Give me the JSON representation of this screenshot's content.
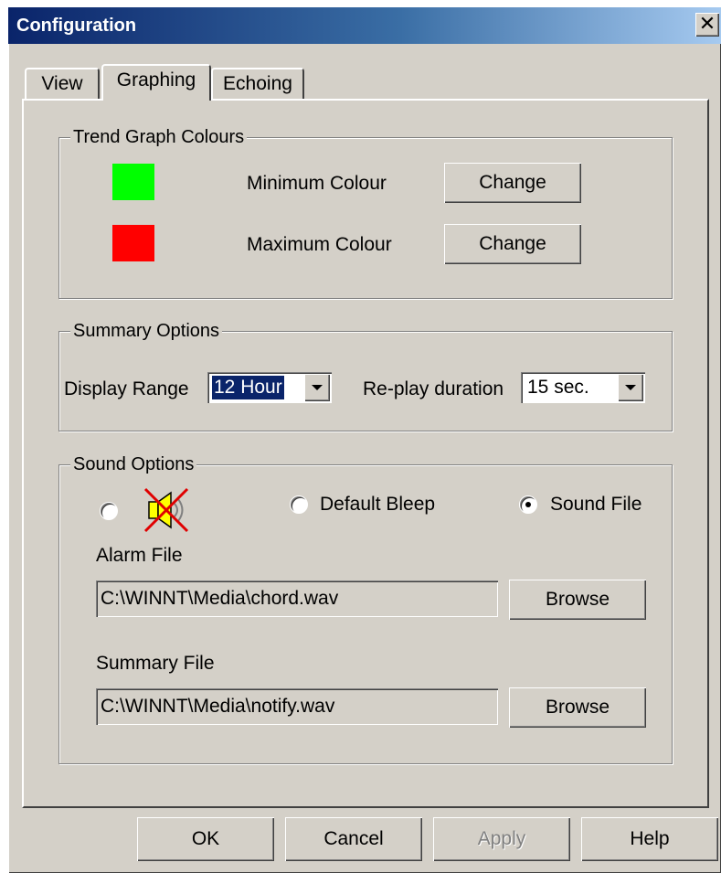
{
  "window": {
    "title": "Configuration",
    "close_glyph": "✕"
  },
  "tabs": [
    {
      "label": "View"
    },
    {
      "label": "Graphing",
      "active": true
    },
    {
      "label": "Echoing"
    }
  ],
  "trend_graph": {
    "legend": "Trend Graph Colours",
    "minimum": {
      "label": "Minimum Colour",
      "color": "#00ff00",
      "button": "Change"
    },
    "maximum": {
      "label": "Maximum Colour",
      "color": "#ff0000",
      "button": "Change"
    }
  },
  "summary": {
    "legend": "Summary Options",
    "display_range_label": "Display Range",
    "display_range_value": "12 Hour",
    "replay_label": "Re-play duration",
    "replay_value": "15 sec."
  },
  "sound": {
    "legend": "Sound Options",
    "mute_icon": "muted-speaker-icon",
    "default_bleep_label": "Default Bleep",
    "sound_file_label": "Sound File",
    "selected": "Sound File",
    "alarm_label": "Alarm File",
    "alarm_path": "C:\\WINNT\\Media\\chord.wav",
    "summary_label": "Summary File",
    "summary_path": "C:\\WINNT\\Media\\notify.wav",
    "browse_label": "Browse"
  },
  "footer": {
    "ok": "OK",
    "cancel": "Cancel",
    "apply": "Apply",
    "help": "Help"
  }
}
